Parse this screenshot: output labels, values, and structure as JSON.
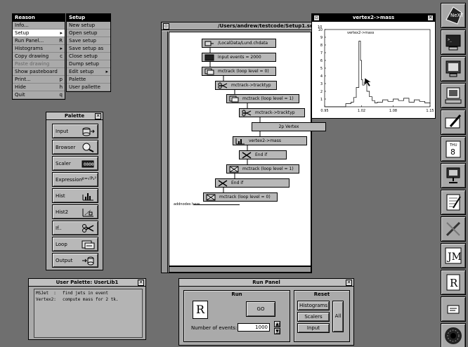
{
  "reason_menu": {
    "title": "Reason",
    "items": [
      {
        "label": "Info...",
        "key": ""
      },
      {
        "label": "Setup",
        "key": "",
        "selected": true,
        "submenu": true
      },
      {
        "label": "Run Panel...",
        "key": "R"
      },
      {
        "label": "Histograms",
        "key": "",
        "submenu": true
      },
      {
        "label": "Copy drawing",
        "key": "c"
      },
      {
        "label": "Paste drawing",
        "key": "",
        "disabled": true
      },
      {
        "label": "Show pasteboard",
        "key": ""
      },
      {
        "label": "Print...",
        "key": "p"
      },
      {
        "label": "Hide",
        "key": "h"
      },
      {
        "label": "Quit",
        "key": "q"
      }
    ]
  },
  "setup_menu": {
    "title": "Setup",
    "items": [
      {
        "label": "New setup"
      },
      {
        "label": "Open setup"
      },
      {
        "label": "Save setup"
      },
      {
        "label": "Save setup as"
      },
      {
        "label": "Close setup"
      },
      {
        "label": "Dump setup"
      },
      {
        "label": "Edit setup",
        "submenu": true
      },
      {
        "label": "Palette"
      },
      {
        "label": "User pallette"
      }
    ]
  },
  "palette": {
    "title": "Palette",
    "close": "✕",
    "items": [
      "Input",
      "Browser",
      "Scaler",
      "Expression",
      "Hist",
      "Hist2",
      "If..",
      "Loop",
      "Output"
    ],
    "expression_icon_text": "x=√P₂²"
  },
  "setup_window": {
    "title": "/Users/andrew/testcode/Setup1.setup",
    "nodes": [
      {
        "label": "/LocalData/Lund.chdata"
      },
      {
        "label": "input events = 2000"
      },
      {
        "label": "mctrack (loop level = 0)"
      },
      {
        "label": "mctrack->tracktyp"
      },
      {
        "label": "mctrack (loop level = 1)"
      },
      {
        "label": "mctrack->tracktyp"
      },
      {
        "label": "2p Vertex"
      },
      {
        "label": "vertex2->mass"
      },
      {
        "label": "End if"
      },
      {
        "label": "mctrack (loop level = 1)"
      },
      {
        "label": "End if"
      },
      {
        "label": "mctrack (loop level = 0)"
      }
    ],
    "add_nodes_label": "addnodes here"
  },
  "histogram_window": {
    "title": "vertex2->mass",
    "close": "✕"
  },
  "chart_data": {
    "type": "line",
    "title": "vertex2->mass",
    "xlabel": "",
    "ylabel": "",
    "xlim": [
      0.95,
      1.15
    ],
    "ylim": [
      0,
      10
    ],
    "y_axis_max_label": "10",
    "x_ticks": [
      "0.95",
      "1.02",
      "1.08",
      "1.15"
    ],
    "y_ticks": [
      "1",
      "2",
      "3",
      "4",
      "5",
      "6",
      "7",
      "8",
      "9",
      "10"
    ],
    "x": [
      0.95,
      0.96,
      0.97,
      0.98,
      0.99,
      1.0,
      1.005,
      1.01,
      1.015,
      1.018,
      1.02,
      1.022,
      1.025,
      1.03,
      1.035,
      1.04,
      1.045,
      1.05,
      1.06,
      1.07,
      1.08,
      1.09,
      1.1,
      1.11,
      1.12,
      1.13,
      1.14,
      1.15
    ],
    "y": [
      0,
      0,
      0,
      0,
      0.4,
      0.6,
      1.2,
      2.5,
      8.5,
      6.0,
      3.5,
      2.8,
      3.2,
      2.0,
      1.3,
      0.8,
      0.5,
      0.6,
      0.9,
      0.7,
      1.0,
      0.8,
      1.1,
      0.6,
      0.9,
      0.7,
      0.5,
      0.4
    ]
  },
  "user_palette": {
    "title": "User Palette: UserLib1",
    "close": "✕",
    "items": [
      {
        "name": "MSJet  :",
        "desc": "find jets in event"
      },
      {
        "name": "Vertex2:",
        "desc": "compute mass for 2 tk."
      }
    ]
  },
  "run_panel": {
    "title": "Run Panel",
    "close": "✕",
    "run_section": "Run",
    "go_label": "GO",
    "events_label": "Number of events:",
    "events_value": "1000",
    "reset_section": "Reset",
    "reset_buttons": [
      "Histograms",
      "Scalers",
      "Input"
    ],
    "all_label": "All"
  },
  "dock": {
    "items": [
      "next-logo-icon",
      "terminal-icon",
      "monitor-icon",
      "computer-icon",
      "mail-pen-icon",
      "calendar-icon",
      "workstation-icon",
      "notepad-icon",
      "tools-icon",
      "app-jm-icon",
      "app-r-icon",
      "preferences-icon",
      "blackhole-icon"
    ],
    "calendar_day": "8",
    "calendar_month": "THU"
  },
  "colors": {
    "desktop": "#6f6f6f",
    "window": "#aaaaaa",
    "titlebar": "#000000"
  }
}
